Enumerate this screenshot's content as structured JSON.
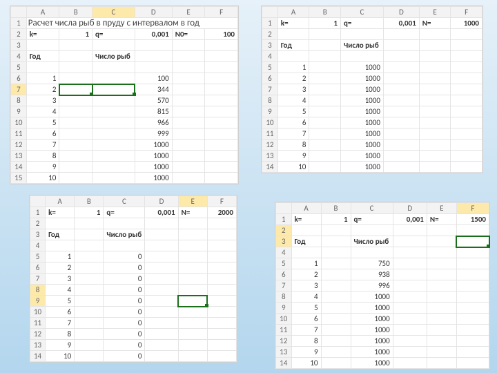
{
  "columns": [
    "A",
    "B",
    "C",
    "D",
    "E",
    "F"
  ],
  "labelYear": "Год",
  "labelFish": "Число рыб",
  "sheets": {
    "s1": {
      "title": "Расчет числа рыб в пруду с интервалом в год",
      "p_k_lbl": "k=",
      "p_k_val": "1",
      "p_q_lbl": "q=",
      "p_q_val": "0,001",
      "p_n_lbl": "N0=",
      "p_n_val": "100",
      "rows": [
        [
          "1",
          "100"
        ],
        [
          "2",
          "344"
        ],
        [
          "3",
          "570"
        ],
        [
          "4",
          "815"
        ],
        [
          "5",
          "966"
        ],
        [
          "6",
          "999"
        ],
        [
          "7",
          "1000"
        ],
        [
          "8",
          "1000"
        ],
        [
          "9",
          "1000"
        ],
        [
          "10",
          "1000"
        ]
      ]
    },
    "s2": {
      "p_k_lbl": "k=",
      "p_k_val": "1",
      "p_q_lbl": "q=",
      "p_q_val": "0,001",
      "p_n_lbl": "N=",
      "p_n_val": "1000",
      "rows": [
        [
          "1",
          "1000"
        ],
        [
          "2",
          "1000"
        ],
        [
          "3",
          "1000"
        ],
        [
          "4",
          "1000"
        ],
        [
          "5",
          "1000"
        ],
        [
          "6",
          "1000"
        ],
        [
          "7",
          "1000"
        ],
        [
          "8",
          "1000"
        ],
        [
          "9",
          "1000"
        ],
        [
          "10",
          "1000"
        ]
      ]
    },
    "s3": {
      "p_k_lbl": "k=",
      "p_k_val": "1",
      "p_q_lbl": "q=",
      "p_q_val": "0,001",
      "p_n_lbl": "N=",
      "p_n_val": "2000",
      "rows": [
        [
          "1",
          "0"
        ],
        [
          "2",
          "0"
        ],
        [
          "3",
          "0"
        ],
        [
          "4",
          "0"
        ],
        [
          "5",
          "0"
        ],
        [
          "6",
          "0"
        ],
        [
          "7",
          "0"
        ],
        [
          "8",
          "0"
        ],
        [
          "9",
          "0"
        ],
        [
          "10",
          "0"
        ]
      ]
    },
    "s4": {
      "p_k_lbl": "k=",
      "p_k_val": "1",
      "p_q_lbl": "q=",
      "p_q_val": "0,001",
      "p_n_lbl": "N=",
      "p_n_val": "1500",
      "rows": [
        [
          "1",
          "750"
        ],
        [
          "2",
          "938"
        ],
        [
          "3",
          "996"
        ],
        [
          "4",
          "1000"
        ],
        [
          "5",
          "1000"
        ],
        [
          "6",
          "1000"
        ],
        [
          "7",
          "1000"
        ],
        [
          "8",
          "1000"
        ],
        [
          "9",
          "1000"
        ],
        [
          "10",
          "1000"
        ]
      ]
    }
  },
  "chart_data": [
    {
      "type": "table",
      "title": "N0=100",
      "categories": [
        1,
        2,
        3,
        4,
        5,
        6,
        7,
        8,
        9,
        10
      ],
      "values": [
        100,
        344,
        570,
        815,
        966,
        999,
        1000,
        1000,
        1000,
        1000
      ],
      "xlabel": "Год",
      "ylabel": "Число рыб"
    },
    {
      "type": "table",
      "title": "N=1000",
      "categories": [
        1,
        2,
        3,
        4,
        5,
        6,
        7,
        8,
        9,
        10
      ],
      "values": [
        1000,
        1000,
        1000,
        1000,
        1000,
        1000,
        1000,
        1000,
        1000,
        1000
      ],
      "xlabel": "Год",
      "ylabel": "Число рыб"
    },
    {
      "type": "table",
      "title": "N=2000",
      "categories": [
        1,
        2,
        3,
        4,
        5,
        6,
        7,
        8,
        9,
        10
      ],
      "values": [
        0,
        0,
        0,
        0,
        0,
        0,
        0,
        0,
        0,
        0
      ],
      "xlabel": "Год",
      "ylabel": "Число рыб"
    },
    {
      "type": "table",
      "title": "N=1500",
      "categories": [
        1,
        2,
        3,
        4,
        5,
        6,
        7,
        8,
        9,
        10
      ],
      "values": [
        750,
        938,
        996,
        1000,
        1000,
        1000,
        1000,
        1000,
        1000,
        1000
      ],
      "xlabel": "Год",
      "ylabel": "Число рыб"
    }
  ]
}
